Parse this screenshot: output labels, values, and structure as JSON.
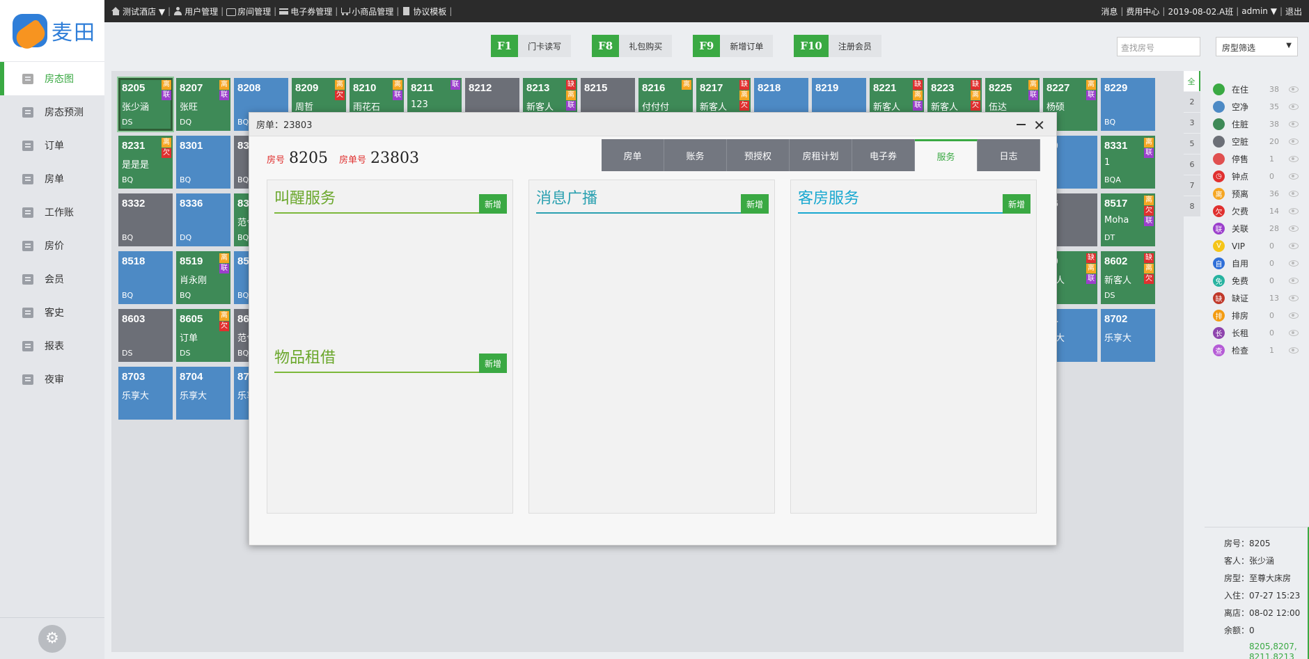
{
  "topbar": {
    "nav": [
      "测试酒店 ▼",
      "用户管理",
      "房间管理",
      "电子券管理",
      "小商品管理",
      "协议模板"
    ],
    "right": [
      "消息",
      "费用中心",
      "2019-08-02.A班",
      "admin ▼",
      "退出"
    ]
  },
  "logo": {
    "text": "麦田"
  },
  "menu": [
    {
      "label": "房态图"
    },
    {
      "label": "房态预测"
    },
    {
      "label": "订单"
    },
    {
      "label": "房单"
    },
    {
      "label": "工作账"
    },
    {
      "label": "房价"
    },
    {
      "label": "会员"
    },
    {
      "label": "客史"
    },
    {
      "label": "报表"
    },
    {
      "label": "夜审"
    }
  ],
  "fkeys": [
    {
      "key": "F1",
      "label": "门卡读写"
    },
    {
      "key": "F8",
      "label": "礼包购买"
    },
    {
      "key": "F9",
      "label": "新增订单"
    },
    {
      "key": "F10",
      "label": "注册会员"
    }
  ],
  "search": {
    "placeholder": "查找房号"
  },
  "filter": {
    "label": "房型筛选"
  },
  "floors": [
    "全",
    "2",
    "3",
    "5",
    "6",
    "7",
    "8"
  ],
  "rooms": [
    {
      "num": "8205",
      "name": "张少涵",
      "code": "DS",
      "status": "live",
      "tags": [
        "离",
        "联"
      ]
    },
    {
      "num": "8207",
      "name": "张旺",
      "code": "DQ",
      "status": "live",
      "tags": [
        "离",
        "联"
      ]
    },
    {
      "num": "8208",
      "name": "",
      "code": "BQA",
      "status": "clean",
      "tags": []
    },
    {
      "num": "8209",
      "name": "周哲",
      "code": "",
      "status": "live",
      "tags": [
        "离",
        "欠"
      ]
    },
    {
      "num": "8210",
      "name": "雨花石",
      "code": "",
      "status": "live",
      "tags": [
        "离",
        "联"
      ]
    },
    {
      "num": "8211",
      "name": "123",
      "code": "",
      "status": "live",
      "tags": [
        "联"
      ]
    },
    {
      "num": "8212",
      "name": "",
      "code": "",
      "status": "dirty",
      "tags": []
    },
    {
      "num": "8213",
      "name": "新客人",
      "code": "",
      "status": "live",
      "tags": [
        "缺",
        "离",
        "联"
      ]
    },
    {
      "num": "8215",
      "name": "",
      "code": "",
      "status": "dirty",
      "tags": []
    },
    {
      "num": "8216",
      "name": "付付付",
      "code": "",
      "status": "live",
      "tags": [
        "离"
      ]
    },
    {
      "num": "8217",
      "name": "新客人",
      "code": "",
      "status": "live",
      "tags": [
        "缺",
        "离",
        "欠"
      ]
    },
    {
      "num": "8218",
      "name": "",
      "code": "",
      "status": "clean",
      "tags": []
    },
    {
      "num": "8219",
      "name": "",
      "code": "",
      "status": "clean",
      "tags": []
    },
    {
      "num": "8221",
      "name": "新客人",
      "code": "",
      "status": "live",
      "tags": [
        "缺",
        "离",
        "联"
      ]
    },
    {
      "num": "8223",
      "name": "新客人",
      "code": "",
      "status": "live",
      "tags": [
        "缺",
        "离",
        "欠"
      ]
    },
    {
      "num": "8225",
      "name": "伍达",
      "code": "",
      "status": "live",
      "tags": [
        "离",
        "联"
      ]
    },
    {
      "num": "8227",
      "name": "杨硕",
      "code": "",
      "status": "live",
      "tags": [
        "离",
        "联"
      ]
    },
    {
      "num": "8229",
      "name": "",
      "code": "BQ",
      "status": "clean",
      "tags": []
    },
    {
      "num": "8231",
      "name": "是是是",
      "code": "BQ",
      "status": "live",
      "tags": [
        "离",
        "欠"
      ]
    },
    {
      "num": "8301",
      "name": "",
      "code": "BQ",
      "status": "clean",
      "tags": []
    },
    {
      "num": "83",
      "name": "",
      "code": "BQA",
      "status": "dirty",
      "tags": []
    },
    {
      "num": "30",
      "name": "",
      "code": "",
      "status": "clean",
      "tags": []
    },
    {
      "num": "8331",
      "name": "1",
      "code": "BQA",
      "status": "live",
      "tags": [
        "离",
        "联"
      ]
    },
    {
      "num": "8332",
      "name": "",
      "code": "BQ",
      "status": "dirty",
      "tags": []
    },
    {
      "num": "8336",
      "name": "",
      "code": "DQ",
      "status": "clean",
      "tags": []
    },
    {
      "num": "83",
      "name": "范令",
      "code": "BQ",
      "status": "live",
      "tags": []
    },
    {
      "num": "16",
      "name": "",
      "code": "",
      "status": "dirty",
      "tags": []
    },
    {
      "num": "8517",
      "name": "Moha",
      "code": "DT",
      "status": "live",
      "tags": [
        "离",
        "欠",
        "联"
      ]
    },
    {
      "num": "8518",
      "name": "",
      "code": "BQ",
      "status": "clean",
      "tags": []
    },
    {
      "num": "8519",
      "name": "肖永刚",
      "code": "BQ",
      "status": "live",
      "tags": [
        "离",
        "联"
      ]
    },
    {
      "num": "85",
      "name": "",
      "code": "BQ",
      "status": "clean",
      "tags": []
    },
    {
      "num": "40",
      "name": "客人",
      "code": "A",
      "status": "live",
      "tags": [
        "缺",
        "离",
        "联"
      ]
    },
    {
      "num": "8602",
      "name": "新客人",
      "code": "DS",
      "status": "live",
      "tags": [
        "缺",
        "离",
        "欠"
      ]
    },
    {
      "num": "8603",
      "name": "",
      "code": "DS",
      "status": "dirty",
      "tags": []
    },
    {
      "num": "8605",
      "name": "订单",
      "code": "DS",
      "status": "live",
      "tags": [
        "离",
        "欠"
      ]
    },
    {
      "num": "86",
      "name": "范令",
      "code": "BQ",
      "status": "dirty",
      "tags": []
    },
    {
      "num": "01",
      "name": "享大",
      "code": "",
      "status": "clean",
      "tags": []
    },
    {
      "num": "8702",
      "name": "乐享大",
      "code": "",
      "status": "clean",
      "tags": []
    },
    {
      "num": "8703",
      "name": "乐享大",
      "code": "",
      "status": "clean",
      "tags": []
    },
    {
      "num": "8704",
      "name": "乐享大",
      "code": "",
      "status": "clean",
      "tags": []
    },
    {
      "num": "87",
      "name": "乐享",
      "code": "",
      "status": "clean",
      "tags": []
    }
  ],
  "legend": [
    {
      "label": "在住",
      "count": "38",
      "color": "#3aa943",
      "glyph": ""
    },
    {
      "label": "空净",
      "count": "35",
      "color": "#4d8ac5",
      "glyph": ""
    },
    {
      "label": "住脏",
      "count": "38",
      "color": "#3e8a57",
      "glyph": ""
    },
    {
      "label": "空脏",
      "count": "20",
      "color": "#6c6f77",
      "glyph": ""
    },
    {
      "label": "停售",
      "count": "1",
      "color": "#e05050",
      "glyph": ""
    },
    {
      "label": "钟点",
      "count": "0",
      "color": "#e0302f",
      "glyph": "◷"
    },
    {
      "label": "预离",
      "count": "36",
      "color": "#f5a623",
      "glyph": "离"
    },
    {
      "label": "欠费",
      "count": "14",
      "color": "#e0302f",
      "glyph": "欠"
    },
    {
      "label": "关联",
      "count": "28",
      "color": "#9b3fcc",
      "glyph": "联"
    },
    {
      "label": "VIP",
      "count": "0",
      "color": "#f5c518",
      "glyph": "V"
    },
    {
      "label": "自用",
      "count": "0",
      "color": "#2f6fd8",
      "glyph": "自"
    },
    {
      "label": "免费",
      "count": "0",
      "color": "#27b3a0",
      "glyph": "免"
    },
    {
      "label": "缺证",
      "count": "13",
      "color": "#c0392b",
      "glyph": "缺"
    },
    {
      "label": "排房",
      "count": "0",
      "color": "#f39c12",
      "glyph": "排"
    },
    {
      "label": "长租",
      "count": "0",
      "color": "#8e44ad",
      "glyph": "长"
    },
    {
      "label": "检查",
      "count": "1",
      "color": "#b55bd6",
      "glyph": "查"
    }
  ],
  "info": {
    "room": "房号：8205",
    "guest": "客人：张少涵",
    "type": "房型：至尊大床房",
    "checkin": "入住：07-27 15:23",
    "checkout": "离店：08-02 12:00",
    "balance": "余额：0",
    "related": "8205,8207,",
    "related2": "8211,8213"
  },
  "modal": {
    "title": "房单：23803",
    "room_label": "房号",
    "room_value": "8205",
    "order_label": "房单号",
    "order_value": "23803",
    "tabs": [
      "房单",
      "账务",
      "预授权",
      "房租计划",
      "电子券",
      "服务",
      "日志"
    ],
    "active_tab": 5,
    "sections": {
      "wakeup": "叫醒服务",
      "broadcast": "消息广播",
      "housekeeping": "客房服务",
      "rental": "物品租借"
    },
    "add_label": "新增"
  }
}
